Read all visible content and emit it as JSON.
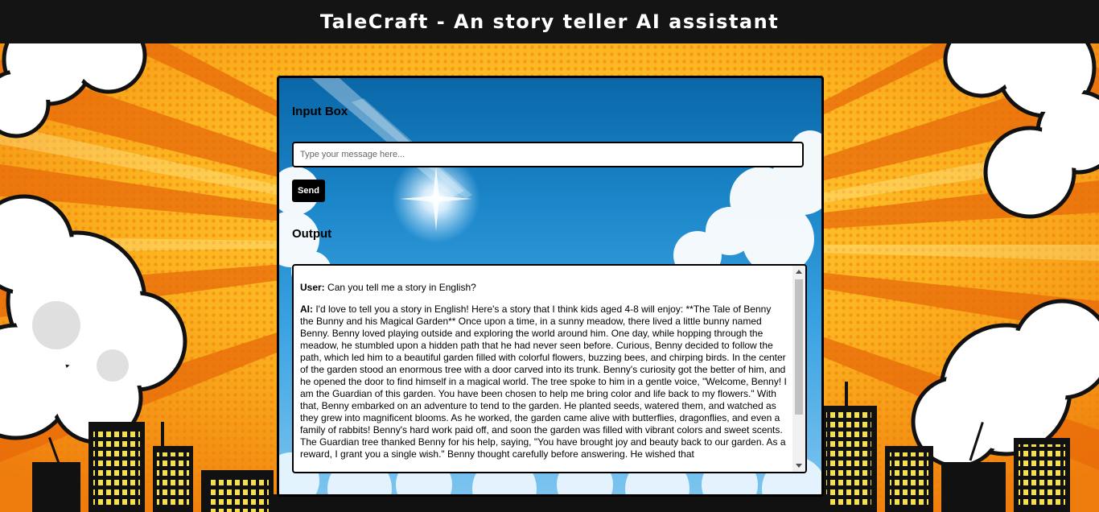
{
  "header": {
    "title": "TaleCraft - An story teller AI assistant"
  },
  "panel": {
    "input_label": "Input Box",
    "input_placeholder": "Type your message here...",
    "input_value": "",
    "send_label": "Send",
    "output_label": "Output"
  },
  "conversation": {
    "user_prefix": "User:",
    "user_message": "Can you tell me a story in English?",
    "ai_prefix": "AI:",
    "ai_message": "I'd love to tell you a story in English! Here's a story that I think kids aged 4-8 will enjoy: **The Tale of Benny the Bunny and his Magical Garden** Once upon a time, in a sunny meadow, there lived a little bunny named Benny. Benny loved playing outside and exploring the world around him. One day, while hopping through the meadow, he stumbled upon a hidden path that he had never seen before. Curious, Benny decided to follow the path, which led him to a beautiful garden filled with colorful flowers, buzzing bees, and chirping birds. In the center of the garden stood an enormous tree with a door carved into its trunk. Benny's curiosity got the better of him, and he opened the door to find himself in a magical world. The tree spoke to him in a gentle voice, \"Welcome, Benny! I am the Guardian of this garden. You have been chosen to help me bring color and life back to my flowers.\" With that, Benny embarked on an adventure to tend to the garden. He planted seeds, watered them, and watched as they grew into magnificent blooms. As he worked, the garden came alive with butterflies, dragonflies, and even a family of rabbits! Benny's hard work paid off, and soon the garden was filled with vibrant colors and sweet scents. The Guardian tree thanked Benny for his help, saying, \"You have brought joy and beauty back to our garden. As a reward, I grant you a single wish.\" Benny thought carefully before answering. He wished that"
  },
  "colors": {
    "header_bg": "#141414",
    "background_orange": "#f7a416",
    "panel_border": "#000000",
    "send_button_bg": "#000000"
  }
}
